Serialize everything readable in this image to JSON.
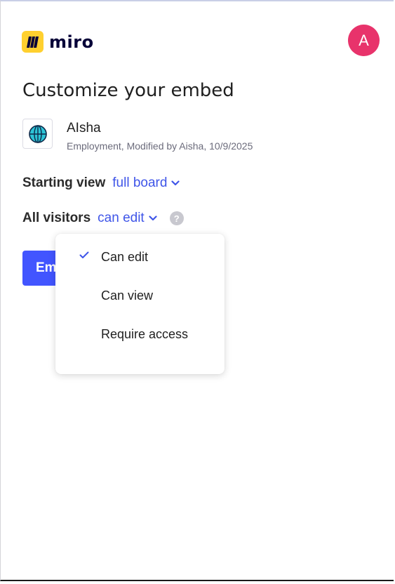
{
  "header": {
    "logo_text": "miro",
    "avatar_initial": "A",
    "avatar_color": "#e8336b",
    "brand_color": "#ffd02f"
  },
  "page": {
    "title": "Customize your embed"
  },
  "board": {
    "name": "AIsha",
    "meta": "Employment, Modified by Aisha, 10/9/2025",
    "icon": "globe-icon"
  },
  "settings": {
    "starting_view_label": "Starting view",
    "starting_view_value": "full board",
    "visitors_label": "All visitors",
    "visitors_value": "can edit",
    "help_glyph": "?"
  },
  "embed_button": {
    "label": "Em"
  },
  "dropdown": {
    "options": [
      {
        "label": "Can edit",
        "selected": true
      },
      {
        "label": "Can view",
        "selected": false
      },
      {
        "label": "Require access",
        "selected": false
      }
    ]
  },
  "colors": {
    "accent": "#4255ff",
    "link": "#3f55e8"
  }
}
